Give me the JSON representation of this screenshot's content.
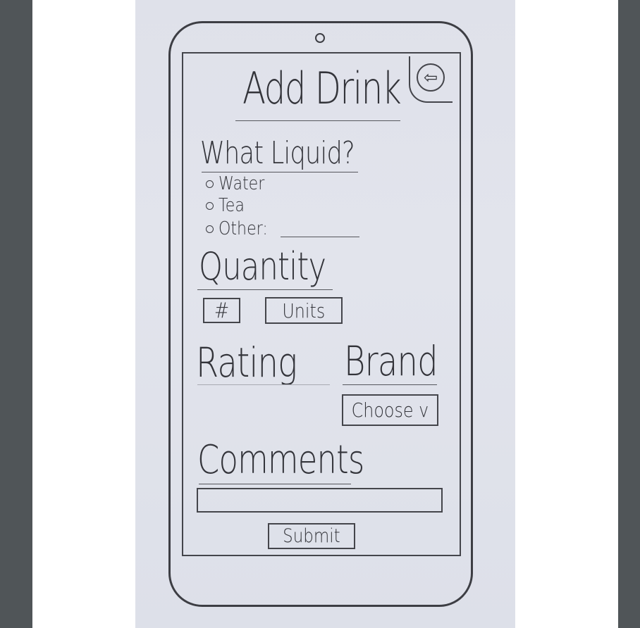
{
  "screen": {
    "title": "Add Drink",
    "back_icon": "back-arrow-icon"
  },
  "liquid": {
    "heading": "What Liquid?",
    "options": [
      {
        "label": "Water"
      },
      {
        "label": "Tea"
      },
      {
        "label": "Other:"
      }
    ]
  },
  "quantity": {
    "heading": "Quantity",
    "number_placeholder": "#",
    "units_label": "Units"
  },
  "rating": {
    "heading": "Rating"
  },
  "brand": {
    "heading": "Brand",
    "dropdown_label": "Choose v"
  },
  "comments": {
    "heading": "Comments"
  },
  "submit_label": "Submit"
}
